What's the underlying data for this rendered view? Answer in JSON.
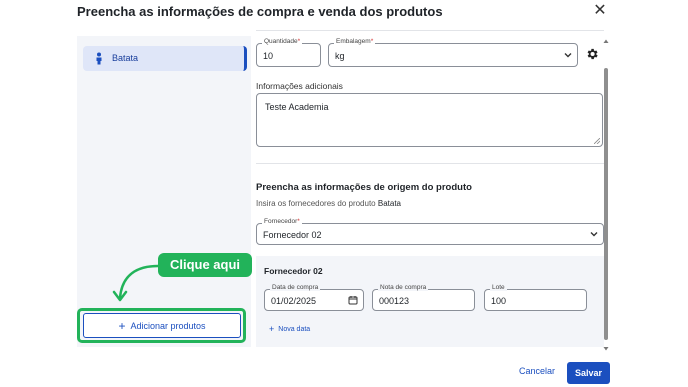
{
  "modal": {
    "title": "Preencha as informações de compra e venda dos produtos",
    "close_icon": "close-icon"
  },
  "sidebar": {
    "items": [
      {
        "label": "Batata",
        "icon": "person-icon",
        "selected": true
      }
    ],
    "add_button_label": "Adicionar produtos"
  },
  "callout": {
    "text": "Clique aqui",
    "color": "#22b35a"
  },
  "form": {
    "quantity": {
      "label": "Quantidade",
      "value": "10"
    },
    "packaging": {
      "label": "Embalagem",
      "value": "kg"
    },
    "info": {
      "label": "Informações adicionais",
      "value": "Teste Academia"
    },
    "origin": {
      "title": "Preencha as informações de origem do produto",
      "subtitle_prefix": "Insira os fornecedores do produto",
      "subtitle_product": "Batata"
    },
    "supplier": {
      "label": "Fornecedor",
      "value": "Fornecedor 02"
    },
    "supplier_card": {
      "title": "Fornecedor 02",
      "purchase_date": {
        "label": "Data de compra",
        "value": "01/02/2025"
      },
      "invoice": {
        "label": "Nota de compra",
        "value": "000123"
      },
      "batch": {
        "label": "Lote",
        "value": "100"
      },
      "new_date_label": "Nova data"
    }
  },
  "footer": {
    "cancel_label": "Cancelar",
    "save_label": "Salvar"
  },
  "colors": {
    "primary": "#1b4fbf",
    "highlight": "#22b35a",
    "panel_bg": "#f3f5f9"
  }
}
